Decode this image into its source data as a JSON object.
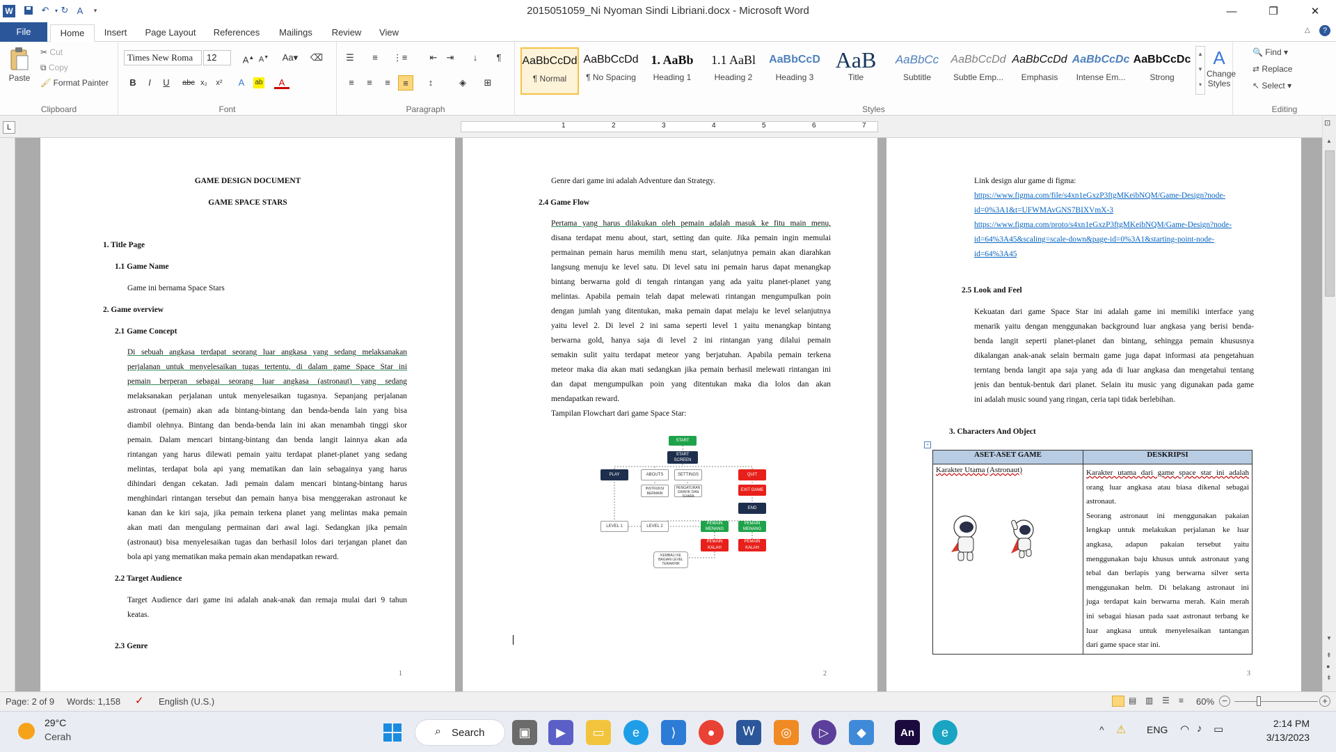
{
  "window": {
    "title": "2015051059_Ni Nyoman Sindi Libriani.docx - Microsoft Word"
  },
  "tabs": [
    "File",
    "Home",
    "Insert",
    "Page Layout",
    "References",
    "Mailings",
    "Review",
    "View"
  ],
  "clipboard": {
    "paste": "Paste",
    "cut": "Cut",
    "copy": "Copy",
    "format_painter": "Format Painter",
    "label": "Clipboard"
  },
  "font": {
    "name": "Times New Roma",
    "size": "12",
    "label": "Font"
  },
  "paragraph": {
    "label": "Paragraph"
  },
  "styles": {
    "label": "Styles",
    "items": [
      {
        "preview": "AaBbCcDd",
        "name": "¶ Normal"
      },
      {
        "preview": "AaBbCcDd",
        "name": "¶ No Spacing"
      },
      {
        "preview": "1. AaBb",
        "name": "Heading 1"
      },
      {
        "preview": "1.1 AaBl",
        "name": "Heading 2"
      },
      {
        "preview": "AaBbCcD",
        "name": "Heading 3"
      },
      {
        "preview": "AaB",
        "name": "Title"
      },
      {
        "preview": "AaBbCc",
        "name": "Subtitle"
      },
      {
        "preview": "AaBbCcDd",
        "name": "Subtle Emp..."
      },
      {
        "preview": "AaBbCcDd",
        "name": "Emphasis"
      },
      {
        "preview": "AaBbCcDc",
        "name": "Intense Em..."
      },
      {
        "preview": "AaBbCcDc",
        "name": "Strong"
      }
    ],
    "change_styles": "Change Styles"
  },
  "editing": {
    "find": "Find",
    "replace": "Replace",
    "select": "Select",
    "label": "Editing"
  },
  "ruler": {
    "marks": [
      "1",
      "2",
      "3",
      "4",
      "5",
      "6",
      "7"
    ]
  },
  "page1": {
    "title1": "GAME DESIGN DOCUMENT",
    "title2": "GAME SPACE STARS",
    "h1": "1.   Title Page",
    "h11": "1.1 Game Name",
    "name_text": "Game ini bernama Space Stars",
    "h2": "2.   Game overview",
    "h21": "2.1 Game Concept",
    "concept": [
      "Di sebuah angkasa terdapat seorang luar angkasa yang sedang melaksanakan",
      "perjalanan untuk menyelesaikan tugas tertentu, di dalam game Space Star ini",
      "pemain berperan sebagai seorang luar angkasa (astronaut) yang sedang",
      "melaksanakan perjalanan untuk menyelesaikan tugasnya. Sepanjang perjalanan",
      "astronaut (pemain) akan ada bintang-bintang dan benda-benda lain yang bisa",
      "diambil olehnya. Bintang dan benda-benda lain ini akan menambah tinggi skor",
      "pemain. Dalam mencari bintang-bintang dan benda langit lainnya akan ada",
      "rintangan yang harus dilewati pemain yaitu terdapat planet-planet yang sedang",
      "melintas, terdapat bola api yang mematikan dan lain sebagainya yang harus",
      "dihindari dengan cekatan. Jadi pemain dalam mencari bintang-bintang harus",
      "menghindari rintangan tersebut dan pemain hanya bisa menggerakan astronaut ke",
      "kanan dan ke kiri saja, jika pemain terkena planet yang melintas maka pemain",
      "akan mati dan mengulang permainan dari awal lagi. Sedangkan jika pemain",
      "(astronaut) bisa menyelesaikan tugas dan berhasil lolos dari terjangan planet dan",
      "bola api yang mematikan maka pemain akan mendapatkan reward."
    ],
    "h22": "2.2 Target Audience",
    "audience": [
      "Target Audience dari game ini adalah anak-anak dan remaja mulai dari 9 tahun",
      "keatas."
    ],
    "h23": "2.3 Genre",
    "num": "1"
  },
  "page2": {
    "genre": "Genre dari game ini adalah Adventure dan Strategy.",
    "h24": "2.4 Game Flow",
    "flow": [
      "Pertama yang harus dilakukan oleh pemain adalah masuk ke fitu main menu,",
      "disana terdapat menu about, start, setting dan quite. Jika pemain ingin memulai",
      "permainan pemain harus memilih menu start, selanjutnya pemain akan diarahkan",
      "langsung menuju ke level satu. Di level satu ini pemain harus dapat menangkap",
      "bintang berwarna gold di tengah rintangan yang ada yaitu planet-planet  yang",
      "melintas. Apabila pemain telah dapat melewati rintangan mengumpulkan poin",
      "dengan jumlah yang ditentukan, maka pemain dapat melaju ke level selanjutnya",
      "yaitu level 2. Di level 2 ini sama seperti level 1 yaitu menangkap bintang",
      "berwarna gold, hanya saja di level 2 ini rintangan yang dilalui pemain",
      "semakin sulit yaitu terdapat meteor yang berjatuhan. Apabila pemain terkena",
      "meteor maka dia akan mati sedangkan jika pemain berhasil melewati rintangan ini",
      "dan dapat mengumpulkan poin yang ditentukan maka dia lolos dan akan",
      "mendapatkan reward."
    ],
    "flow_caption": "Tampilan Flowchart dari game Space Star:",
    "flowchart": {
      "start": "START",
      "start_screen": "START SCREEN",
      "play": "PLAY",
      "abouts": "ABOUTS",
      "settings": "SETTINGS",
      "quit": "QUIT",
      "instruksi": "INSTRUKSI BERMAIN",
      "pengaturan": "PENGATURAN GRAFIK DAN SUARA",
      "exit": "EXIT GAME",
      "end": "END",
      "level1": "LEVEL 1",
      "level2": "LEVEL 2",
      "menang1": "PEMAIN MENANG",
      "menang2": "PEMAIN MENANG",
      "kalah1": "PEMAIN KALAH",
      "kalah2": "PEMAIN KALAH",
      "kembali": "KEMBALI KE BAGIAN LEVEL TERAKHIR"
    },
    "num": "2"
  },
  "page3": {
    "link_intro": "Link design alur game di figma:",
    "links": [
      "https://www.figma.com/file/s4xn1eGxzP3ftgMKeibNQM/Game-Design?node-",
      "id=0%3A1&t=UFWMAvGNS7BIXVmX-3",
      "https://www.figma.com/proto/s4xn1eGxzP3ftgMKeibNQM/Game-Design?node-",
      "id=64%3A45&scaling=scale-down&page-id=0%3A1&starting-point-node-",
      "id=64%3A45"
    ],
    "h25": "2.5 Look and Feel",
    "look": [
      "Kekuatan dari game Space Star ini adalah game ini memiliki interface yang",
      "menarik yaitu dengan menggunakan background luar angkasa yang berisi benda-",
      "benda langit seperti planet-planet dan bintang, sehingga pemain khususnya",
      "dikalangan anak-anak selain bermain game juga dapat informasi ata pengetahuan",
      "terntang benda langit apa saja yang ada di luar angkasa dan mengetahui tentang",
      "jenis dan bentuk-bentuk dari planet. Selain itu music yang digunakan pada game",
      "ini adalah  music sound yang ringan, ceria tapi tidak berlebihan."
    ],
    "h3": "3.   Characters And Object",
    "table": {
      "col1": "ASET-ASET GAME",
      "col2": "DESKRIPSI",
      "row_name": "Karakter Utama (Astronaut)",
      "desc": [
        "Karakter utama dari game space star ini adalah",
        "orang luar angkasa atau biasa dikenal sebagai",
        "astronaut.",
        "Seorang astronaut ini menggunakan pakaian",
        "lengkap untuk melakukan perjalanan ke luar",
        "angkasa, adapun pakaian tersebut yaitu",
        "menggunakan baju khusus untuk astronaut yang",
        "tebal dan berlapis yang berwarna silver serta",
        "menggunakan helm. Di belakang astronaut ini",
        "juga terdapat kain berwarna merah. Kain merah",
        "ini sebagai hiasan pada saat astronaut terbang ke",
        "luar angkasa untuk menyelesaikan tantangan",
        "dari game space star ini."
      ]
    },
    "num": "3"
  },
  "status": {
    "page": "Page: 2 of 9",
    "words": "Words: 1,158",
    "lang": "English (U.S.)",
    "zoom": "60%"
  },
  "taskbar": {
    "weather_temp": "29°C",
    "weather_desc": "Cerah",
    "search": "Search",
    "lang": "ENG",
    "time": "2:14 PM",
    "date": "3/13/2023"
  }
}
